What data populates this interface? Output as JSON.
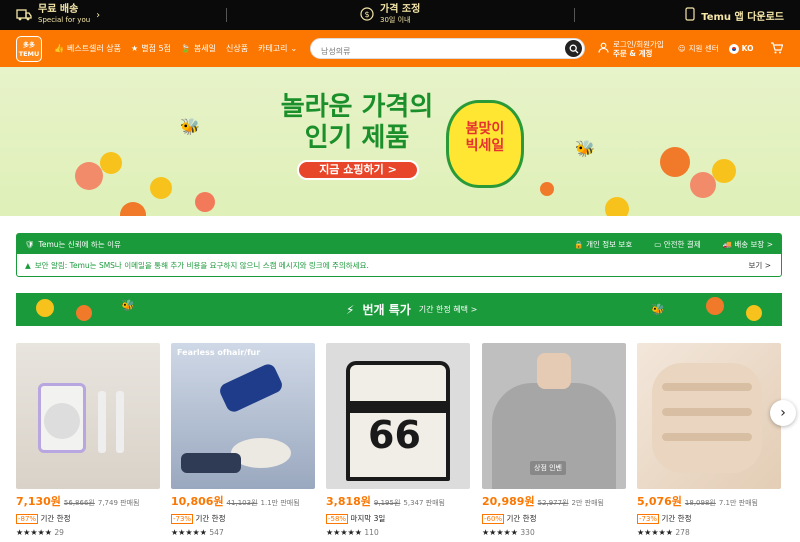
{
  "topbar": {
    "shipping_title": "무료 배송",
    "shipping_sub": "Special for you",
    "price_title": "가격 조정",
    "price_sub": "30일 이내",
    "app_label": "Temu 앱 다운로드"
  },
  "header": {
    "logo_line1": "多多",
    "logo_line2": "TEMU",
    "nav": [
      "베스트셀러 상품",
      "별점 5점",
      "봄세일",
      "신상품",
      "카테고리"
    ],
    "search_placeholder": "남성의류",
    "login_line1": "로그인/회원가입",
    "login_line2": "주문 & 계정",
    "support": "지원 센터",
    "lang": "KO"
  },
  "banner": {
    "title_line1": "놀라운 가격의",
    "title_line2": "인기 제품",
    "cta": "지금 쇼핑하기 >",
    "badge_line1": "봄맞이",
    "badge_line2": "빅세일"
  },
  "trust": {
    "title": "Temu는 신뢰에 하는 이유",
    "items": [
      "개인 정보 보호",
      "안전한 결제",
      "배송 보장 >"
    ],
    "notice": "보안 알림: Temu는 SMS나 이메일을 통해 추가 비용을 요구하지 않으니 스캠 메시지와 링크에 주의하세요.",
    "notice_link": "보기 >"
  },
  "flash": {
    "title": "번개 특가",
    "sub": "기간 한정 혜택 >"
  },
  "products": [
    {
      "price": "7,130원",
      "old": "56,866원",
      "sold": "7,749 판매됨",
      "pct": "-87%",
      "deal": "기간 한정",
      "rating": "29",
      "stars": "★★★★★"
    },
    {
      "price": "10,806원",
      "old": "41,103원",
      "sold": "1.1만 판매됨",
      "pct": "-73%",
      "deal": "기간 한정",
      "rating": "547",
      "stars": "★★★★★"
    },
    {
      "price": "3,818원",
      "old": "9,195원",
      "sold": "5,347 판매됨",
      "pct": "-58%",
      "deal": "마지막 3일",
      "rating": "110",
      "stars": "★★★★★"
    },
    {
      "price": "20,989원",
      "old": "52,977원",
      "sold": "2만 판매됨",
      "pct": "-60%",
      "deal": "기간 한정",
      "rating": "330",
      "stars": "★★★★★"
    },
    {
      "price": "5,076원",
      "old": "18,098원",
      "sold": "7.1만 판매됨",
      "pct": "-73%",
      "deal": "기간 한정",
      "rating": "278",
      "stars": "★★★★★"
    }
  ],
  "product_img_texts": {
    "p1": "Fearless ofhair/fur",
    "p2": "66",
    "p3": "상점 인벤"
  }
}
